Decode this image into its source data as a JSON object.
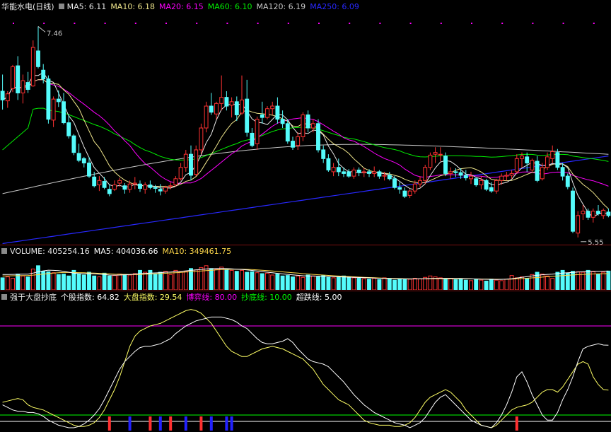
{
  "colors": {
    "up": "#ff3232",
    "down": "#54fcfc",
    "ma5": "#e8e8e8",
    "ma10": "#f0e68c",
    "ma20": "#ff00ff",
    "ma60": "#00ee00",
    "ma120": "#c8c8c8",
    "ma250": "#2828ff",
    "vol_ma5": "#ffffff",
    "vol_ma10": "#ffd84a",
    "sep": "#7a1010",
    "ind_stock": "#ffffff",
    "ind_index": "#ffff66",
    "ind_game": "#ff00ff",
    "ind_bottom": "#00ff00",
    "ind_super": "#ffffff",
    "ind_bar_a": "#ff3030",
    "ind_bar_b": "#2222ff"
  },
  "price_panel": {
    "title": "华能水电(日线)",
    "legend": [
      {
        "label": "MA5: 6.11",
        "color": "#e8e8e8"
      },
      {
        "label": "MA10: 6.18",
        "color": "#f0e68c"
      },
      {
        "label": "MA20: 6.15",
        "color": "#ff00ff"
      },
      {
        "label": "MA60: 6.10",
        "color": "#00ee00"
      },
      {
        "label": "MA120: 6.19",
        "color": "#c8c8c8"
      },
      {
        "label": "MA250: 6.09",
        "color": "#2828ff"
      }
    ],
    "high_label": "7.46",
    "low_label": "5.55"
  },
  "volume_panel": {
    "title": "VOLUME: 405254.16",
    "legend": [
      {
        "label": "MA5: 404036.66",
        "color": "#ffffff"
      },
      {
        "label": "MA10: 349461.75",
        "color": "#ffd84a"
      }
    ]
  },
  "indicator_panel": {
    "title": "强于大盘抄底",
    "legend": [
      {
        "label": "个股指数: 64.82",
        "color": "#ffffff"
      },
      {
        "label": "大盘指数: 29.54",
        "color": "#ffff66"
      },
      {
        "label": "博弈线: 80.00",
        "color": "#ff00ff"
      },
      {
        "label": "抄底线: 10.00",
        "color": "#00ff00"
      },
      {
        "label": "超跌线: 5.00",
        "color": "#ffffff"
      }
    ]
  },
  "chart_data": {
    "type": "candlestick",
    "price_range": [
      5.0,
      7.6
    ],
    "volume_range": [
      0,
      700000
    ],
    "indicator_range": [
      0,
      95
    ],
    "count": 120,
    "ohlc": [
      [
        6.72,
        6.91,
        6.51,
        6.62
      ],
      [
        6.61,
        6.72,
        6.53,
        6.69
      ],
      [
        6.75,
        7.02,
        6.71,
        7.0
      ],
      [
        7.01,
        7.12,
        6.62,
        6.7
      ],
      [
        6.7,
        6.91,
        6.58,
        6.84
      ],
      [
        6.82,
        6.94,
        6.7,
        6.74
      ],
      [
        6.78,
        7.3,
        6.77,
        7.22
      ],
      [
        7.18,
        7.46,
        6.98,
        7.0
      ],
      [
        6.96,
        7.03,
        6.81,
        6.86
      ],
      [
        6.86,
        6.9,
        6.35,
        6.4
      ],
      [
        6.39,
        6.66,
        6.31,
        6.63
      ],
      [
        6.63,
        6.73,
        6.54,
        6.6
      ],
      [
        6.6,
        6.7,
        6.34,
        6.36
      ],
      [
        6.36,
        6.45,
        6.18,
        6.21
      ],
      [
        6.21,
        6.23,
        5.99,
        6.02
      ],
      [
        6.01,
        6.12,
        5.91,
        5.93
      ],
      [
        5.95,
        5.97,
        5.85,
        5.9
      ],
      [
        5.9,
        5.97,
        5.73,
        5.75
      ],
      [
        5.74,
        5.8,
        5.62,
        5.64
      ],
      [
        5.65,
        5.75,
        5.58,
        5.7
      ],
      [
        5.69,
        5.74,
        5.6,
        5.62
      ],
      [
        5.6,
        5.65,
        5.52,
        5.55
      ],
      [
        5.6,
        5.7,
        5.58,
        5.65
      ],
      [
        5.67,
        5.73,
        5.63,
        5.7
      ],
      [
        5.64,
        5.67,
        5.55,
        5.6
      ],
      [
        5.6,
        5.7,
        5.56,
        5.66
      ],
      [
        5.66,
        5.74,
        5.6,
        5.67
      ],
      [
        5.66,
        5.7,
        5.57,
        5.61
      ],
      [
        5.6,
        5.68,
        5.55,
        5.65
      ],
      [
        5.65,
        5.7,
        5.6,
        5.62
      ],
      [
        5.62,
        5.65,
        5.56,
        5.61
      ],
      [
        5.6,
        5.66,
        5.53,
        5.58
      ],
      [
        5.58,
        5.64,
        5.55,
        5.62
      ],
      [
        5.63,
        5.68,
        5.6,
        5.64
      ],
      [
        5.65,
        5.75,
        5.63,
        5.72
      ],
      [
        5.72,
        5.9,
        5.7,
        5.85
      ],
      [
        5.85,
        6.05,
        5.8,
        6.0
      ],
      [
        6.0,
        6.1,
        5.7,
        5.76
      ],
      [
        5.77,
        6.1,
        5.75,
        6.05
      ],
      [
        6.05,
        6.35,
        6.0,
        6.3
      ],
      [
        6.3,
        6.6,
        6.25,
        6.55
      ],
      [
        6.55,
        6.7,
        6.45,
        6.48
      ],
      [
        6.46,
        6.6,
        6.4,
        6.58
      ],
      [
        6.58,
        6.9,
        6.5,
        6.65
      ],
      [
        6.65,
        6.72,
        6.5,
        6.55
      ],
      [
        6.56,
        6.65,
        6.42,
        6.6
      ],
      [
        6.6,
        6.66,
        6.38,
        6.45
      ],
      [
        6.47,
        6.9,
        6.45,
        6.62
      ],
      [
        6.63,
        6.85,
        6.2,
        6.25
      ],
      [
        6.24,
        6.3,
        6.08,
        6.1
      ],
      [
        6.12,
        6.43,
        6.05,
        6.4
      ],
      [
        6.45,
        6.6,
        6.35,
        6.42
      ],
      [
        6.42,
        6.55,
        6.4,
        6.52
      ],
      [
        6.52,
        6.6,
        6.45,
        6.55
      ],
      [
        6.55,
        6.65,
        6.35,
        6.4
      ],
      [
        6.4,
        6.5,
        6.3,
        6.35
      ],
      [
        6.35,
        6.4,
        6.12,
        6.15
      ],
      [
        6.15,
        6.2,
        6.05,
        6.08
      ],
      [
        6.1,
        6.25,
        6.05,
        6.2
      ],
      [
        6.2,
        6.48,
        6.15,
        6.45
      ],
      [
        6.45,
        6.5,
        6.25,
        6.3
      ],
      [
        6.3,
        6.4,
        6.25,
        6.35
      ],
      [
        6.35,
        6.4,
        6.02,
        6.05
      ],
      [
        6.05,
        6.1,
        5.9,
        5.95
      ],
      [
        5.95,
        6.0,
        5.8,
        5.82
      ],
      [
        5.8,
        5.9,
        5.75,
        5.85
      ],
      [
        5.85,
        5.95,
        5.75,
        5.8
      ],
      [
        5.8,
        5.85,
        5.74,
        5.78
      ],
      [
        5.8,
        5.83,
        5.73,
        5.75
      ],
      [
        5.75,
        5.85,
        5.72,
        5.82
      ],
      [
        5.82,
        5.85,
        5.75,
        5.79
      ],
      [
        5.79,
        5.84,
        5.74,
        5.8
      ],
      [
        5.8,
        5.83,
        5.74,
        5.78
      ],
      [
        5.78,
        5.86,
        5.74,
        5.8
      ],
      [
        5.8,
        5.82,
        5.72,
        5.75
      ],
      [
        5.75,
        5.8,
        5.7,
        5.76
      ],
      [
        5.76,
        5.8,
        5.7,
        5.72
      ],
      [
        5.72,
        5.75,
        5.6,
        5.62
      ],
      [
        5.62,
        5.68,
        5.55,
        5.6
      ],
      [
        5.58,
        5.62,
        5.5,
        5.52
      ],
      [
        5.53,
        5.6,
        5.5,
        5.58
      ],
      [
        5.58,
        5.7,
        5.55,
        5.66
      ],
      [
        5.66,
        5.75,
        5.62,
        5.7
      ],
      [
        5.7,
        5.88,
        5.66,
        5.85
      ],
      [
        5.85,
        6.02,
        5.82,
        5.99
      ],
      [
        6.0,
        6.08,
        5.9,
        6.02
      ],
      [
        6.0,
        6.08,
        5.92,
        6.0
      ],
      [
        5.98,
        6.02,
        5.75,
        5.78
      ],
      [
        5.78,
        5.85,
        5.72,
        5.8
      ],
      [
        5.8,
        5.84,
        5.74,
        5.79
      ],
      [
        5.79,
        5.84,
        5.72,
        5.76
      ],
      [
        5.76,
        5.82,
        5.7,
        5.73
      ],
      [
        5.72,
        5.8,
        5.66,
        5.75
      ],
      [
        5.72,
        5.74,
        5.63,
        5.65
      ],
      [
        5.65,
        5.75,
        5.6,
        5.7
      ],
      [
        5.7,
        5.72,
        5.58,
        5.6
      ],
      [
        5.62,
        5.68,
        5.56,
        5.58
      ],
      [
        5.58,
        5.72,
        5.55,
        5.7
      ],
      [
        5.7,
        5.78,
        5.65,
        5.75
      ],
      [
        5.75,
        5.8,
        5.7,
        5.76
      ],
      [
        5.76,
        5.82,
        5.72,
        5.78
      ],
      [
        5.8,
        6.0,
        5.78,
        5.95
      ],
      [
        5.95,
        6.02,
        5.85,
        5.98
      ],
      [
        5.97,
        6.02,
        5.8,
        5.9
      ],
      [
        5.82,
        5.95,
        5.8,
        5.93
      ],
      [
        5.92,
        5.98,
        5.68,
        5.7
      ],
      [
        5.72,
        5.9,
        5.7,
        5.85
      ],
      [
        5.85,
        6.02,
        5.82,
        5.97
      ],
      [
        5.95,
        6.1,
        5.9,
        6.03
      ],
      [
        6.02,
        6.06,
        5.82,
        5.85
      ],
      [
        5.85,
        5.9,
        5.7,
        5.75
      ],
      [
        5.75,
        5.78,
        5.6,
        5.63
      ],
      [
        5.58,
        5.62,
        5.1,
        5.12
      ],
      [
        5.1,
        5.35,
        5.05,
        5.3
      ],
      [
        5.32,
        5.42,
        5.25,
        5.35
      ],
      [
        5.35,
        5.38,
        5.25,
        5.28
      ],
      [
        5.28,
        5.38,
        5.22,
        5.35
      ],
      [
        5.35,
        5.42,
        5.3,
        5.32
      ],
      [
        5.3,
        5.38,
        5.26,
        5.36
      ],
      [
        5.34,
        5.38,
        5.28,
        5.3
      ]
    ],
    "volume": [
      260000,
      280000,
      250000,
      340000,
      300000,
      280000,
      450000,
      520000,
      400000,
      390000,
      370000,
      330000,
      340000,
      300000,
      420000,
      350000,
      320000,
      380000,
      300000,
      280000,
      360000,
      300000,
      310000,
      340000,
      330000,
      320000,
      350000,
      420000,
      380000,
      420000,
      340000,
      380000,
      400000,
      330000,
      420000,
      380000,
      400000,
      460000,
      430000,
      480000,
      520000,
      460000,
      440000,
      490000,
      430000,
      420000,
      400000,
      420000,
      380000,
      390000,
      370000,
      350000,
      360000,
      320000,
      340000,
      300000,
      310000,
      280000,
      300000,
      270000,
      320000,
      300000,
      280000,
      310000,
      270000,
      260000,
      280000,
      300000,
      270000,
      260000,
      250000,
      240000,
      230000,
      250000,
      220000,
      260000,
      240000,
      210000,
      240000,
      220000,
      230000,
      250000,
      240000,
      270000,
      300000,
      280000,
      260000,
      240000,
      250000,
      220000,
      230000,
      210000,
      200000,
      220000,
      210000,
      190000,
      230000,
      210000,
      200000,
      230000,
      310000,
      260000,
      280000,
      250000,
      330000,
      380000,
      340000,
      300000,
      250000,
      380000,
      420000,
      360000,
      400000,
      390000,
      380000,
      420000,
      390000,
      340000,
      380000,
      405254
    ],
    "vol_ma5": [
      330000,
      332000,
      334000,
      336000,
      338000,
      340000,
      360000,
      390000,
      410000,
      425000,
      420000,
      415000,
      400000,
      380000,
      360000,
      350000,
      345000,
      350000,
      345000,
      340000,
      330000,
      320000,
      318000,
      320000,
      325000,
      330000,
      340000,
      350000,
      355000,
      360000,
      365000,
      372000,
      380000,
      385000,
      392000,
      400000,
      410000,
      420000,
      430000,
      440000,
      450000,
      455000,
      458000,
      460000,
      458000,
      452000,
      446000,
      440000,
      430000,
      418000,
      405000,
      392000,
      380000,
      368000,
      356000,
      344000,
      334000,
      324000,
      314000,
      305000,
      300000,
      298000,
      296000,
      294000,
      290000,
      286000,
      282000,
      278000,
      274000,
      270000,
      266000,
      262000,
      258000,
      254000,
      250000,
      246000,
      243000,
      240000,
      238000,
      236000,
      235000,
      236000,
      238000,
      240000,
      243000,
      246000,
      248000,
      250000,
      250000,
      248000,
      246000,
      242000,
      238000,
      234000,
      230000,
      228000,
      226000,
      225000,
      226000,
      230000,
      240000,
      255000,
      270000,
      285000,
      300000,
      315000,
      325000,
      333000,
      340000,
      350000,
      360000,
      370000,
      378000,
      385000,
      390000,
      395000,
      399000,
      402000,
      404000,
      404037
    ],
    "vol_ma10": [
      300000,
      302000,
      304000,
      306000,
      308000,
      310000,
      318000,
      328000,
      340000,
      352000,
      362000,
      370000,
      374000,
      376000,
      375000,
      372000,
      368000,
      364000,
      360000,
      356000,
      352000,
      346000,
      340000,
      336000,
      333000,
      332000,
      332000,
      334000,
      338000,
      342000,
      347000,
      352000,
      358000,
      364000,
      370000,
      376000,
      384000,
      392000,
      400000,
      408000,
      416000,
      423000,
      430000,
      436000,
      440000,
      443000,
      444000,
      444000,
      441000,
      436000,
      430000,
      423000,
      415000,
      406000,
      397000,
      388000,
      379000,
      370000,
      360000,
      350000,
      342000,
      334000,
      326000,
      319000,
      312000,
      305000,
      299000,
      293000,
      287000,
      281000,
      276000,
      271000,
      266000,
      261000,
      257000,
      253000,
      249000,
      246000,
      243000,
      240000,
      238000,
      237000,
      236000,
      236000,
      237000,
      238000,
      239000,
      240000,
      241000,
      241000,
      240000,
      239000,
      237000,
      235000,
      233000,
      231000,
      230000,
      229000,
      229000,
      230000,
      233000,
      238000,
      244000,
      251000,
      259000,
      267000,
      275000,
      283000,
      291000,
      299000,
      307000,
      314000,
      321000,
      328000,
      334000,
      339000,
      343000,
      346000,
      348000,
      349462
    ],
    "ind_stock": [
      18,
      16,
      14,
      13,
      13,
      12,
      12,
      11,
      9,
      6,
      4,
      2,
      1,
      0,
      0,
      1,
      3,
      6,
      10,
      15,
      22,
      30,
      38,
      46,
      52,
      56,
      60,
      63,
      64,
      64,
      65,
      66,
      68,
      70,
      74,
      77,
      80,
      82,
      84,
      85,
      86,
      87,
      87,
      87,
      86,
      85,
      83,
      80,
      78,
      74,
      70,
      67,
      66,
      66,
      67,
      68,
      70,
      67,
      62,
      58,
      54,
      52,
      51,
      50,
      48,
      44,
      40,
      36,
      31,
      26,
      22,
      18,
      15,
      12,
      10,
      8,
      6,
      4,
      3,
      2,
      0,
      2,
      4,
      8,
      14,
      20,
      24,
      26,
      22,
      18,
      14,
      10,
      6,
      4,
      2,
      1,
      0,
      4,
      10,
      18,
      28,
      40,
      44,
      36,
      26,
      18,
      10,
      6,
      6,
      12,
      22,
      30,
      40,
      52,
      62,
      64,
      65,
      66,
      65,
      64.82
    ],
    "ind_index": [
      20,
      21,
      22,
      23,
      22,
      18,
      16,
      15,
      14,
      12,
      10,
      8,
      6,
      4,
      2,
      1,
      1,
      2,
      4,
      8,
      14,
      22,
      30,
      40,
      52,
      64,
      72,
      76,
      78,
      80,
      81,
      82,
      84,
      86,
      88,
      90,
      92,
      93,
      92,
      90,
      86,
      82,
      76,
      70,
      64,
      60,
      58,
      56,
      56,
      58,
      60,
      62,
      63,
      64,
      63,
      62,
      60,
      58,
      56,
      54,
      50,
      46,
      40,
      34,
      30,
      26,
      22,
      20,
      18,
      14,
      10,
      6,
      4,
      3,
      2,
      2,
      2,
      1,
      1,
      2,
      4,
      8,
      14,
      20,
      24,
      26,
      28,
      30,
      28,
      24,
      20,
      14,
      10,
      6,
      2,
      1,
      0,
      2,
      6,
      10,
      14,
      16,
      17,
      18,
      20,
      24,
      28,
      30,
      30,
      28,
      32,
      38,
      44,
      50,
      52,
      50,
      40,
      34,
      30,
      29.54
    ],
    "game_line": 80,
    "bottom_line": 10,
    "super_line": 5,
    "signal_bars": [
      {
        "i": 21,
        "kind": "red"
      },
      {
        "i": 25,
        "kind": "blue"
      },
      {
        "i": 29,
        "kind": "red"
      },
      {
        "i": 31,
        "kind": "blue"
      },
      {
        "i": 33,
        "kind": "red"
      },
      {
        "i": 36,
        "kind": "blue"
      },
      {
        "i": 39,
        "kind": "red"
      },
      {
        "i": 41,
        "kind": "blue"
      },
      {
        "i": 44,
        "kind": "blue"
      },
      {
        "i": 45,
        "kind": "blue"
      },
      {
        "i": 101,
        "kind": "red"
      }
    ]
  }
}
